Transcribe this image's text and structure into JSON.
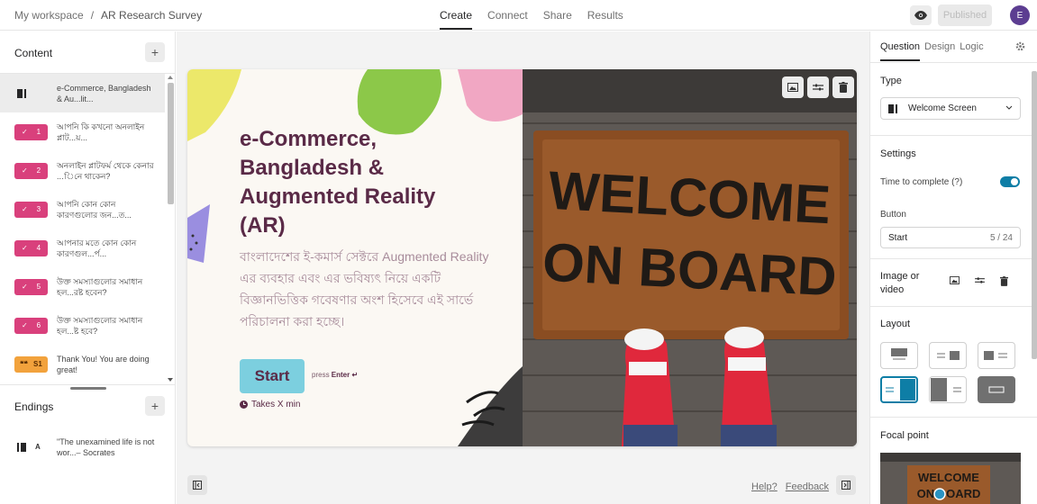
{
  "topbar": {
    "breadcrumb_workspace": "My workspace",
    "breadcrumb_sep": "/",
    "breadcrumb_form": "AR Research Survey",
    "tabs": [
      "Create",
      "Connect",
      "Share",
      "Results"
    ],
    "active_tab": "Create",
    "preview_icon": "eye-icon",
    "publish_label": "Published",
    "avatar_initial": "E"
  },
  "content_panel": {
    "title": "Content",
    "add_icon": "plus-icon",
    "items": [
      {
        "badge": "",
        "icon": "welcome-screen-icon",
        "text": "e-Commerce, Bangladesh & Au...lit...",
        "selected": true,
        "color": ""
      },
      {
        "badge": "1",
        "icon": "check-icon",
        "text": "আপনি কি কখনো অনলাইন প্লাট...য়...",
        "color": "#d9407c"
      },
      {
        "badge": "2",
        "icon": "check-icon",
        "text": "অনলাইন প্লাটফর্ম থেকে কেনার ...িনে থাকেন?",
        "color": "#d9407c"
      },
      {
        "badge": "3",
        "icon": "check-icon",
        "text": "আপনি কোন কোন কারণগুলোর জন...ত...",
        "color": "#d9407c"
      },
      {
        "badge": "4",
        "icon": "check-icon",
        "text": "আপনার মতে কোন কোন কারণগুল...র্প...",
        "color": "#d9407c"
      },
      {
        "badge": "5",
        "icon": "check-icon",
        "text": "উক্ত সমস্যাগুলোর সমাধান হল...রষ্ট হবেন?",
        "color": "#d9407c"
      },
      {
        "badge": "6",
        "icon": "check-icon",
        "text": "উক্ত সমস্যাগুলোর সমাধান হল...ষ্ট হবে?",
        "color": "#d9407c"
      },
      {
        "badge": "S1",
        "icon": "quote-icon",
        "text": "Thank You! You are doing great!",
        "color": "#f2a23c"
      }
    ]
  },
  "endings_panel": {
    "title": "Endings",
    "add_icon": "plus-icon",
    "items": [
      {
        "badge": "A",
        "icon": "ending-screen-icon",
        "text": "\"The unexamined life is not wor...– Socrates"
      }
    ]
  },
  "welcome": {
    "title": "e-Commerce, Bangladesh & Augmented Reality (AR)",
    "description": "বাংলাদেশের ই-কমার্স সেক্টরে Augmented Reality এর ব্যবহার এবং এর ভবিষ্যৎ নিয়ে একটি বিজ্ঞানভিত্তিক গবেষণার অংশ হিসেবে এই সার্ভে পরিচালনা করা হচ্ছে।",
    "button_label": "Start",
    "press_label": "press",
    "press_key": "Enter ↵",
    "time_label": "Takes X min",
    "time_icon": "clock-icon",
    "mat_line1": "WELCOME",
    "mat_line2": "ON BOARD"
  },
  "media_toolbar": {
    "icons": [
      "image-icon",
      "sliders-icon",
      "trash-icon"
    ]
  },
  "footer": {
    "help": "Help?",
    "feedback": "Feedback",
    "left_collapse_icon": "collapse-left-icon",
    "right_collapse_icon": "collapse-right-icon"
  },
  "settings_panel": {
    "tabs": [
      "Question",
      "Design",
      "Logic"
    ],
    "active_tab": "Question",
    "gear_icon": "gear-icon",
    "type_label": "Type",
    "type_value": "Welcome Screen",
    "settings_label": "Settings",
    "time_to_complete": "Time to complete (?)",
    "time_to_complete_on": true,
    "button_label": "Button",
    "button_value": "Start",
    "button_count": "5 / 24",
    "image_label": "Image or video",
    "layout_label": "Layout",
    "focal_label": "Focal point",
    "focal_line1": "WELCOME",
    "focal_line2": "ON BOARD",
    "accent": "#0e7ea6"
  }
}
